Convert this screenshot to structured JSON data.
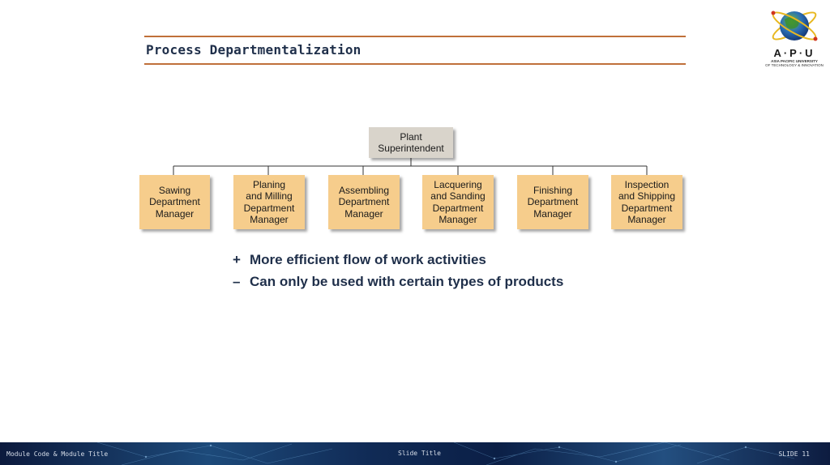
{
  "slide": {
    "title": "Process Departmentalization"
  },
  "logo": {
    "wordmark": "A·P·U",
    "line1": "ASIA PACIFIC UNIVERSITY",
    "line2": "OF TECHNOLOGY & INNOVATION"
  },
  "org_chart": {
    "root": "Plant\nSuperintendent",
    "departments": [
      "Sawing\nDepartment\nManager",
      "Planing\nand Milling\nDepartment\nManager",
      "Assembling\nDepartment\nManager",
      "Lacquering\nand Sanding\nDepartment\nManager",
      "Finishing\nDepartment\nManager",
      "Inspection\nand Shipping\nDepartment\nManager"
    ]
  },
  "bullets": [
    {
      "symbol": "+",
      "text": "More efficient flow of work activities"
    },
    {
      "symbol": "–",
      "text": "Can only be used with certain types of products"
    }
  ],
  "footer": {
    "left": "Module Code & Module Title",
    "center": "Slide Title",
    "right": "SLIDE 11"
  },
  "colors": {
    "accent_line": "#c0703a",
    "root_box": "#d9d4cb",
    "dept_box": "#f6cd8c",
    "title_text": "#1f2f4a"
  }
}
